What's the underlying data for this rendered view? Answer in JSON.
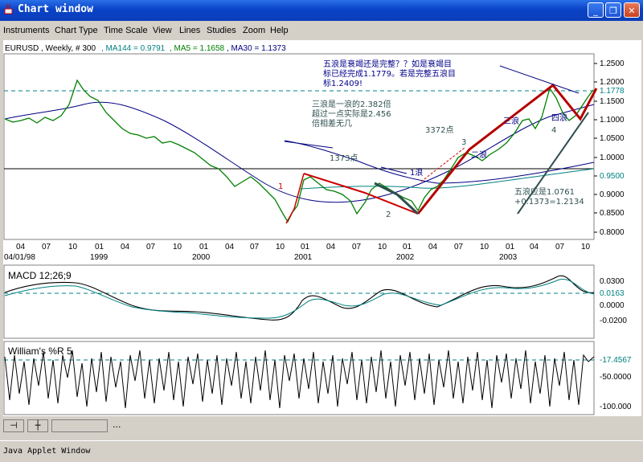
{
  "window": {
    "title": "Chart window"
  },
  "menu": [
    "Instruments",
    "Chart Type",
    "Time Scale",
    "View",
    "Lines",
    "Studies",
    "Zoom",
    "Help"
  ],
  "info": {
    "symbol": "EURUSD , Weekly, # 300",
    "ma144": ", MA144 = 0.9791",
    "ma5": ", MA5 = 1.1658",
    "ma30": ", MA30 = 1.1373"
  },
  "price_axis": [
    "1.2500",
    "1.2000",
    "1.1500",
    "1.1000",
    "1.0500",
    "1.0000",
    "0.9500",
    "0.9000",
    "0.8500",
    "0.8000"
  ],
  "price_markers": {
    "upper": "1.1778",
    "lower": "0.9500"
  },
  "x_months": [
    "04",
    "07",
    "10",
    "01",
    "04",
    "07",
    "10",
    "01",
    "04",
    "07",
    "10",
    "01",
    "04",
    "07",
    "10",
    "01",
    "04",
    "07",
    "10",
    "01",
    "04",
    "07",
    "10"
  ],
  "x_years": [
    "04/01/98",
    "1999",
    "2000",
    "2001",
    "2002",
    "2003"
  ],
  "annotations": {
    "wave_question": [
      "五浪是衰竭还是完整？？如是衰竭目",
      "标已经完成1.1779。若是完整五浪目",
      "标1.2409!"
    ],
    "wave3_ratio": [
      "三浪是一浪的2.382倍",
      "超过一点实际是2.456",
      "倍相差无几"
    ],
    "pts_1373": "1373点",
    "pts_3372": "3372点",
    "wave1": "1浪",
    "wave2": "二浪",
    "wave3": "三浪",
    "wave4": "四浪",
    "wave5_target": [
      "五浪应是1.0761",
      "+0.1373=1.2134"
    ],
    "n1": "1",
    "n2": "2",
    "n3": "3",
    "n4": "4"
  },
  "macd": {
    "label": "MACD 12;26;9",
    "axis": [
      "0.0300",
      "0.0163",
      "0.0000",
      "-0.0200"
    ]
  },
  "williams": {
    "label": "William's %R 5",
    "axis": [
      "-17.4567",
      "-50.0000",
      "-100.000"
    ]
  },
  "statusbar": {
    "text": "Java Applet Window",
    "dots": "..."
  },
  "colors": {
    "titlebar": "#0a43c8",
    "grid": "#008080",
    "wave_line": "#cc0000",
    "price": "#008000",
    "ma": "#000080"
  }
}
